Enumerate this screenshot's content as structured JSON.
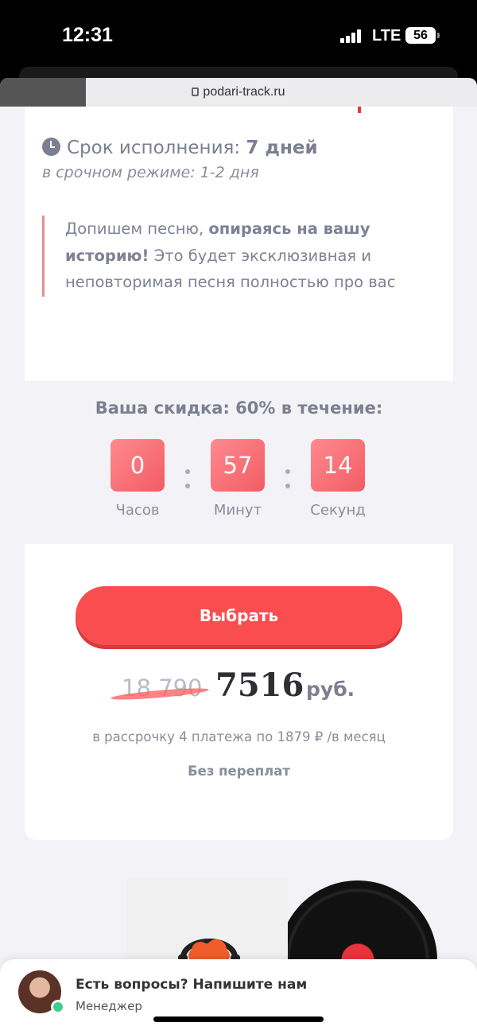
{
  "status": {
    "time": "12:31",
    "network": "LTE",
    "battery": "56"
  },
  "browser": {
    "url": "podari-track.ru"
  },
  "offer": {
    "deadline_label": "Срок исполнения:",
    "deadline_value": "7 дней",
    "urgent_text": "в срочном режиме: 1-2 дня",
    "quote_plain_1": "Допишем песню,",
    "quote_bold": "опираясь на вашу историю!",
    "quote_plain_2": "Это будет эксклюзивная и неповторимая песня полностью про вас"
  },
  "discount": {
    "prefix": "Ваша скидка:",
    "percent": "60%",
    "suffix": "в течение:",
    "hours": "0",
    "minutes": "57",
    "seconds": "14",
    "hours_label": "Часов",
    "minutes_label": "Минут",
    "seconds_label": "Секунд"
  },
  "purchase": {
    "button_label": "Выбрать",
    "old_price": "18 790",
    "new_price": "7516",
    "currency": "руб.",
    "installment": "в рассрочку 4 платежа по 1879 ₽ /в месяц",
    "no_overpay": "Без переплат"
  },
  "chat": {
    "title": "Есть вопросы? Напишите нам",
    "subtitle": "Менеджер"
  },
  "colors": {
    "accent": "#fa4d4f",
    "timer_gradient_start": "#ff8a8f",
    "timer_gradient_end": "#f25c63",
    "muted_text": "#7b7f91",
    "online": "#3ecf8e"
  }
}
